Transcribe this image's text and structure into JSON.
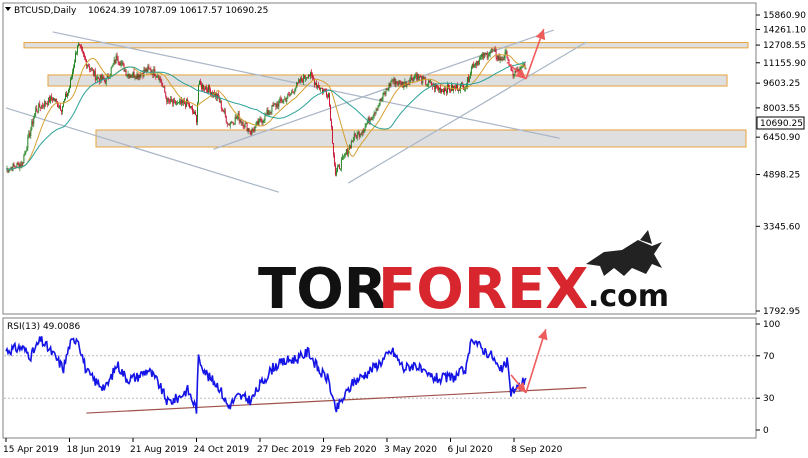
{
  "header": {
    "symbol": "BTCUSD,Daily",
    "ohlc": "10624.39 10787.09 10617.57 10690.25"
  },
  "rsi_header": {
    "label": "RSI(13) 49.0086"
  },
  "current_price": {
    "label": "10690.25"
  },
  "logo": {
    "part1": "TOR",
    "part2": "FOREX",
    "part3": ".com"
  },
  "colors": {
    "bull": "#1b7f1b",
    "bear": "#c8102e",
    "ma_fast": "#d4a032",
    "ma_slow": "#2aa198",
    "rsi": "#1414e6",
    "zone_fill": "#d9d9d9",
    "zone_border": "#e8a33a",
    "channel": "#a9b6c6",
    "arrow": "#ef5c5c",
    "support": "#a0524a",
    "grid": "#b8b8b8"
  },
  "chart_data": [
    {
      "type": "candlestick",
      "symbol": "BTCUSD",
      "timeframe": "Daily",
      "last": {
        "open": 10624.39,
        "high": 10787.09,
        "low": 10617.57,
        "close": 10690.25
      },
      "ylim": [
        1792.95,
        15860.9
      ],
      "y_ticks": [
        "15860.90",
        "14261.10",
        "12708.55",
        "11155.90",
        "9603.25",
        "8003.55",
        "6450.90",
        "4898.25",
        "3345.60",
        "1792.95"
      ],
      "x_ticks": [
        "15 Apr 2019",
        "18 Jun 2019",
        "21 Aug 2019",
        "24 Oct 2019",
        "27 Dec 2019",
        "29 Feb 2020",
        "3 May 2020",
        "6 Jul 2020",
        "8 Sep 2020"
      ],
      "price_path": [
        [
          "2019-04-15",
          5100
        ],
        [
          "2019-05-01",
          5300
        ],
        [
          "2019-05-15",
          7900
        ],
        [
          "2019-06-01",
          8600
        ],
        [
          "2019-06-10",
          8000
        ],
        [
          "2019-06-18",
          9300
        ],
        [
          "2019-06-26",
          12800
        ],
        [
          "2019-07-05",
          11200
        ],
        [
          "2019-07-15",
          10000
        ],
        [
          "2019-07-25",
          9800
        ],
        [
          "2019-08-05",
          11700
        ],
        [
          "2019-08-15",
          10300
        ],
        [
          "2019-08-25",
          10200
        ],
        [
          "2019-09-05",
          10600
        ],
        [
          "2019-09-15",
          10300
        ],
        [
          "2019-09-25",
          8400
        ],
        [
          "2019-10-05",
          8200
        ],
        [
          "2019-10-15",
          8300
        ],
        [
          "2019-10-24",
          7400
        ],
        [
          "2019-10-26",
          9500
        ],
        [
          "2019-11-05",
          9200
        ],
        [
          "2019-11-15",
          8600
        ],
        [
          "2019-11-25",
          7100
        ],
        [
          "2019-12-05",
          7500
        ],
        [
          "2019-12-18",
          6700
        ],
        [
          "2019-12-27",
          7250
        ],
        [
          "2020-01-10",
          8100
        ],
        [
          "2020-01-25",
          8700
        ],
        [
          "2020-02-05",
          9700
        ],
        [
          "2020-02-14",
          10300
        ],
        [
          "2020-02-25",
          9300
        ],
        [
          "2020-03-05",
          8900
        ],
        [
          "2020-03-12",
          4900
        ],
        [
          "2020-03-16",
          5200
        ],
        [
          "2020-03-30",
          6400
        ],
        [
          "2020-04-10",
          6900
        ],
        [
          "2020-04-29",
          8700
        ],
        [
          "2020-05-08",
          9800
        ],
        [
          "2020-05-20",
          9500
        ],
        [
          "2020-06-01",
          10200
        ],
        [
          "2020-06-10",
          9700
        ],
        [
          "2020-06-25",
          9200
        ],
        [
          "2020-07-10",
          9250
        ],
        [
          "2020-07-22",
          9500
        ],
        [
          "2020-07-28",
          11000
        ],
        [
          "2020-08-10",
          11800
        ],
        [
          "2020-08-17",
          12200
        ],
        [
          "2020-08-25",
          11400
        ],
        [
          "2020-09-01",
          11900
        ],
        [
          "2020-09-05",
          10300
        ],
        [
          "2020-09-12",
          10450
        ],
        [
          "2020-09-18",
          10900
        ],
        [
          "2020-09-20",
          10690
        ]
      ],
      "annotations": {
        "resistance_zones": [
          [
            12450,
            12950
          ],
          [
            9400,
            10200
          ],
          [
            6000,
            6800
          ]
        ],
        "channel_lines": [
          {
            "from": [
              "2019-06-01",
              14000
            ],
            "to": [
              "2020-10-24",
              6400
            ]
          },
          {
            "from": [
              "2019-04-15",
              8000
            ],
            "to": [
              "2020-01-15",
              4300
            ]
          },
          {
            "from": [
              "2019-11-10",
              5900
            ],
            "to": [
              "2020-10-18",
              14200
            ]
          },
          {
            "from": [
              "2020-03-25",
              4600
            ],
            "to": [
              "2020-11-20",
              13000
            ]
          }
        ],
        "forecast_arrows": [
          {
            "from": [
              "2020-09-01",
              11200
            ],
            "to": [
              "2020-09-20",
              9900
            ]
          },
          {
            "from": [
              "2020-09-20",
              9900
            ],
            "to": [
              "2020-10-08",
              14300
            ]
          }
        ]
      }
    },
    {
      "type": "line",
      "name": "RSI(13)",
      "last": 49.0086,
      "ylim": [
        0,
        100
      ],
      "y_ticks": [
        "100",
        "70",
        "30",
        "0"
      ],
      "x": [
        "2019-04-15",
        "2019-05-01",
        "2019-05-10",
        "2019-05-20",
        "2019-06-01",
        "2019-06-12",
        "2019-06-18",
        "2019-06-26",
        "2019-07-05",
        "2019-07-15",
        "2019-07-25",
        "2019-08-05",
        "2019-08-15",
        "2019-08-25",
        "2019-09-05",
        "2019-09-15",
        "2019-09-25",
        "2019-10-05",
        "2019-10-15",
        "2019-10-24",
        "2019-10-26",
        "2019-11-05",
        "2019-11-15",
        "2019-11-25",
        "2019-12-05",
        "2019-12-18",
        "2019-12-27",
        "2020-01-10",
        "2020-01-25",
        "2020-02-05",
        "2020-02-14",
        "2020-02-25",
        "2020-03-05",
        "2020-03-12",
        "2020-03-20",
        "2020-03-30",
        "2020-04-10",
        "2020-04-29",
        "2020-05-08",
        "2020-05-20",
        "2020-06-01",
        "2020-06-10",
        "2020-06-25",
        "2020-07-10",
        "2020-07-22",
        "2020-07-28",
        "2020-08-05",
        "2020-08-17",
        "2020-08-25",
        "2020-09-01",
        "2020-09-05",
        "2020-09-12",
        "2020-09-20"
      ],
      "values": [
        75,
        78,
        70,
        85,
        72,
        58,
        80,
        88,
        55,
        45,
        40,
        62,
        48,
        50,
        57,
        45,
        26,
        30,
        38,
        20,
        68,
        50,
        42,
        22,
        32,
        28,
        42,
        60,
        66,
        68,
        74,
        55,
        48,
        18,
        30,
        45,
        52,
        66,
        75,
        58,
        62,
        52,
        48,
        50,
        58,
        88,
        78,
        70,
        55,
        64,
        36,
        40,
        49.0086
      ],
      "annotations": {
        "support_line": {
          "from": [
            "2019-07-05",
            16
          ],
          "to": [
            "2020-11-20",
            40
          ]
        },
        "forecast_arrows": [
          {
            "from": [
              "2020-09-05",
              52
            ],
            "to": [
              "2020-09-20",
              35
            ]
          },
          {
            "from": [
              "2020-09-20",
              35
            ],
            "to": [
              "2020-10-10",
              95
            ]
          }
        ]
      }
    }
  ]
}
